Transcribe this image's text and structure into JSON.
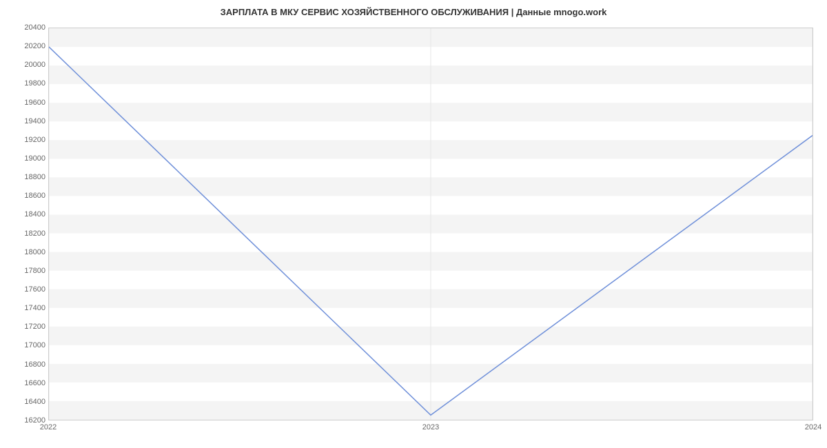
{
  "chart_data": {
    "type": "line",
    "title": "ЗАРПЛАТА В МКУ СЕРВИС ХОЗЯЙСТВЕННОГО ОБСЛУЖИВАНИЯ | Данные mnogo.work",
    "x": [
      2022,
      2023,
      2024
    ],
    "values": [
      20200,
      16250,
      19250
    ],
    "xlabel": "",
    "ylabel": "",
    "x_ticks": [
      2022,
      2023,
      2024
    ],
    "y_ticks": [
      16200,
      16400,
      16600,
      16800,
      17000,
      17200,
      17400,
      17600,
      17800,
      18000,
      18200,
      18400,
      18600,
      18800,
      19000,
      19200,
      19400,
      19600,
      19800,
      20000,
      20200,
      20400
    ],
    "xlim": [
      2022,
      2024
    ],
    "ylim": [
      16200,
      20400
    ],
    "line_color": "#6e8fd9",
    "grid_band_color": "#f4f4f4"
  }
}
